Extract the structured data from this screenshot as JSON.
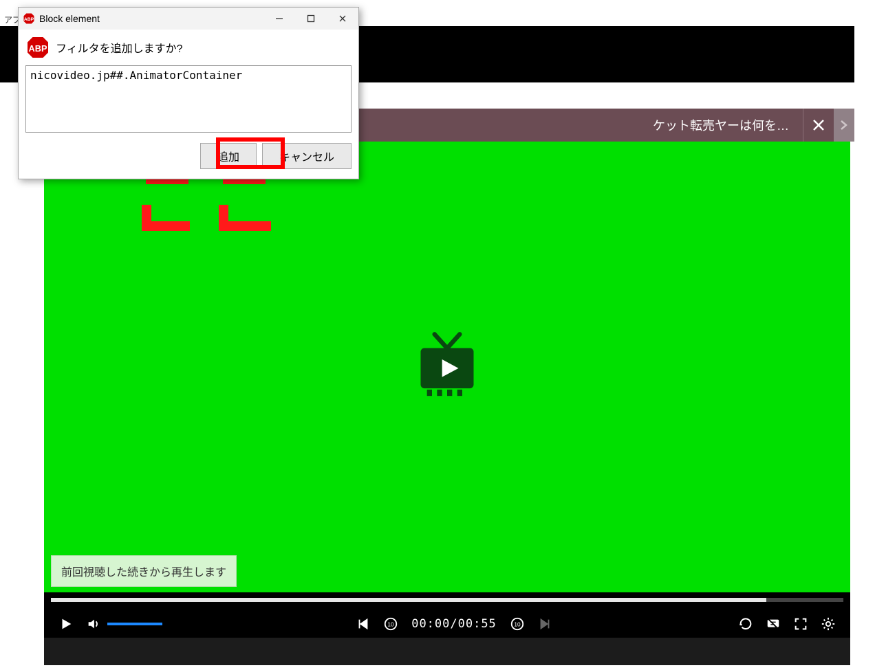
{
  "browser": {
    "apps_label": "アプ",
    "url_hint": ""
  },
  "abp_dialog": {
    "title": "Block element",
    "prompt": "フィルタを追加しますか?",
    "filter_value": "nicovideo.jp##.AnimatorContainer",
    "add_button": "追加",
    "cancel_button": "キャンセル"
  },
  "ticker": {
    "text": "ケット転売ヤーは何を…"
  },
  "video": {
    "resume_toast": "前回視聴した続きから再生します"
  },
  "player": {
    "time_current": "00:00",
    "time_total": "00:55",
    "time_display": "00:00/00:55"
  }
}
